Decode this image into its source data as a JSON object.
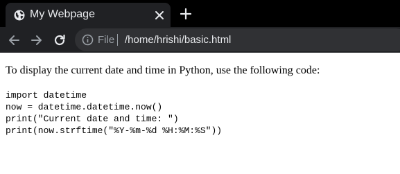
{
  "browser": {
    "tab": {
      "title": "My Webpage",
      "favicon": "globe-icon",
      "close_icon": "close-icon"
    },
    "new_tab_icon": "plus-icon",
    "toolbar": {
      "back_icon": "arrow-left-icon",
      "forward_icon": "arrow-right-icon",
      "reload_icon": "reload-icon",
      "info_icon": "info-icon",
      "scheme_label": "File",
      "url": "/home/hrishi/basic.html"
    },
    "colors": {
      "tab_strip": "#000000",
      "toolbar": "#202124",
      "omnibox": "#303134",
      "text_light": "#e8eaed",
      "text_muted": "#9aa0a6"
    }
  },
  "page": {
    "intro": "To display the current date and time in Python, use the following code:",
    "code_lines": [
      "import datetime",
      "now = datetime.datetime.now()",
      "print(\"Current date and time: \")",
      "print(now.strftime(\"%Y-%m-%d %H:%M:%S\"))"
    ]
  }
}
